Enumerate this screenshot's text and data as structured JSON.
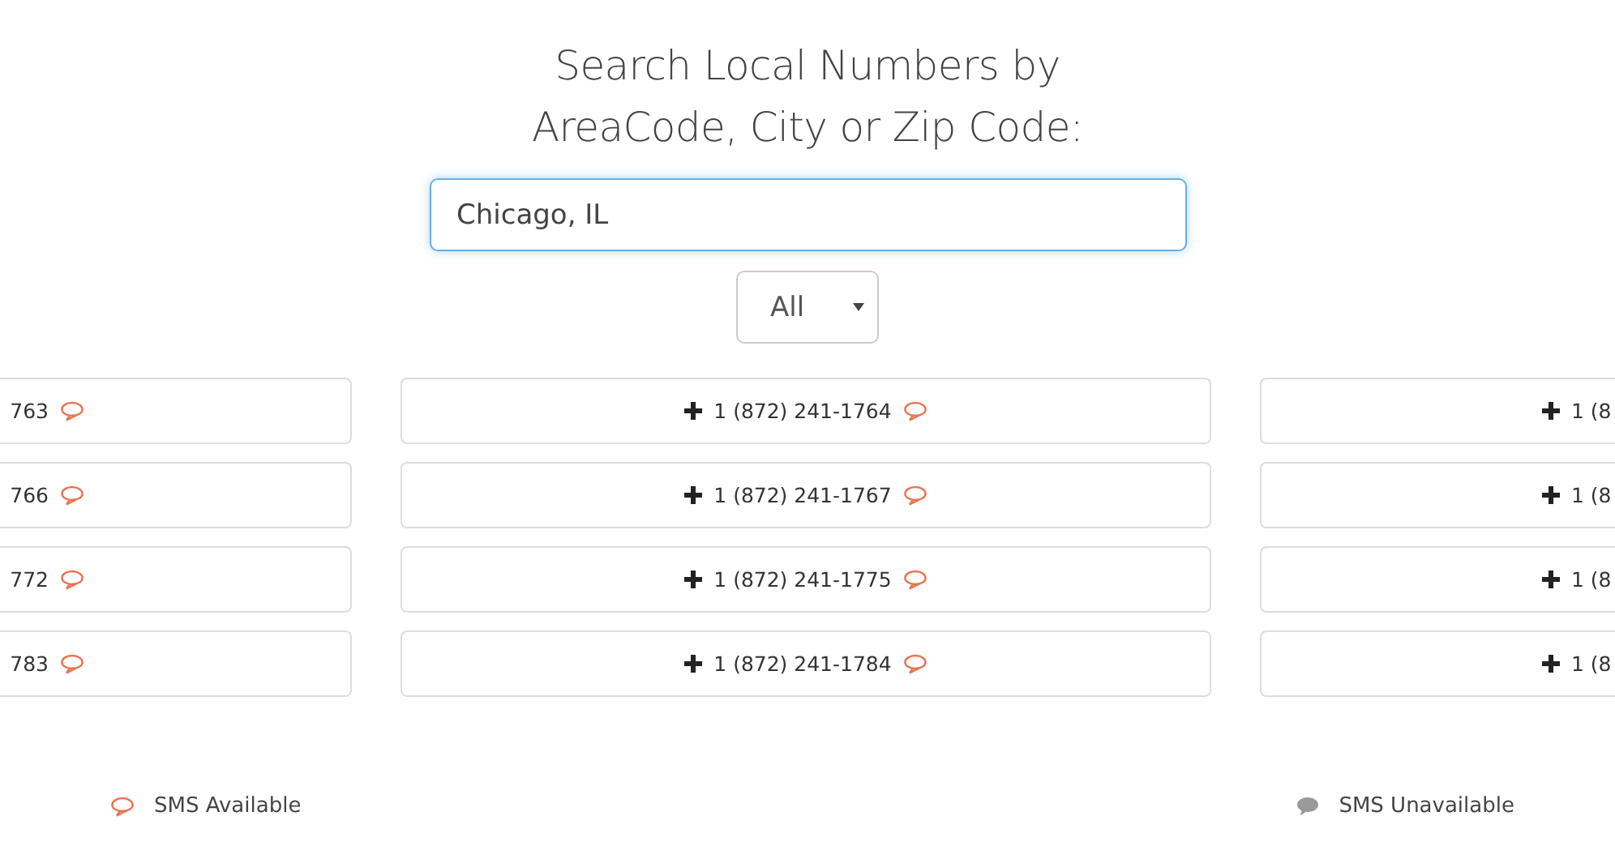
{
  "heading": [
    "Search Local Numbers by",
    "AreaCode, City or Zip Code:"
  ],
  "search": {
    "value": "Chicago, IL"
  },
  "filter": {
    "value": "All"
  },
  "columns": [
    {
      "kind": "cut-start",
      "numbers": [
        {
          "number": "763",
          "sms": true
        },
        {
          "number": "766",
          "sms": true
        },
        {
          "number": "772",
          "sms": true
        },
        {
          "number": "783",
          "sms": true
        }
      ]
    },
    {
      "kind": "full",
      "numbers": [
        {
          "number": "1 (872) 241-1764",
          "sms": true
        },
        {
          "number": "1 (872) 241-1767",
          "sms": true
        },
        {
          "number": "1 (872) 241-1775",
          "sms": true
        },
        {
          "number": "1 (872) 241-1784",
          "sms": true
        }
      ]
    },
    {
      "kind": "cut-end",
      "numbers": [
        {
          "number": "1 (8"
        },
        {
          "number": "1 (8"
        },
        {
          "number": "1 (8"
        },
        {
          "number": "1 (8"
        }
      ]
    }
  ],
  "legend": [
    {
      "label": "SMS Available",
      "sms": true
    },
    {
      "label": "SMS Unavailable",
      "sms": false
    }
  ]
}
